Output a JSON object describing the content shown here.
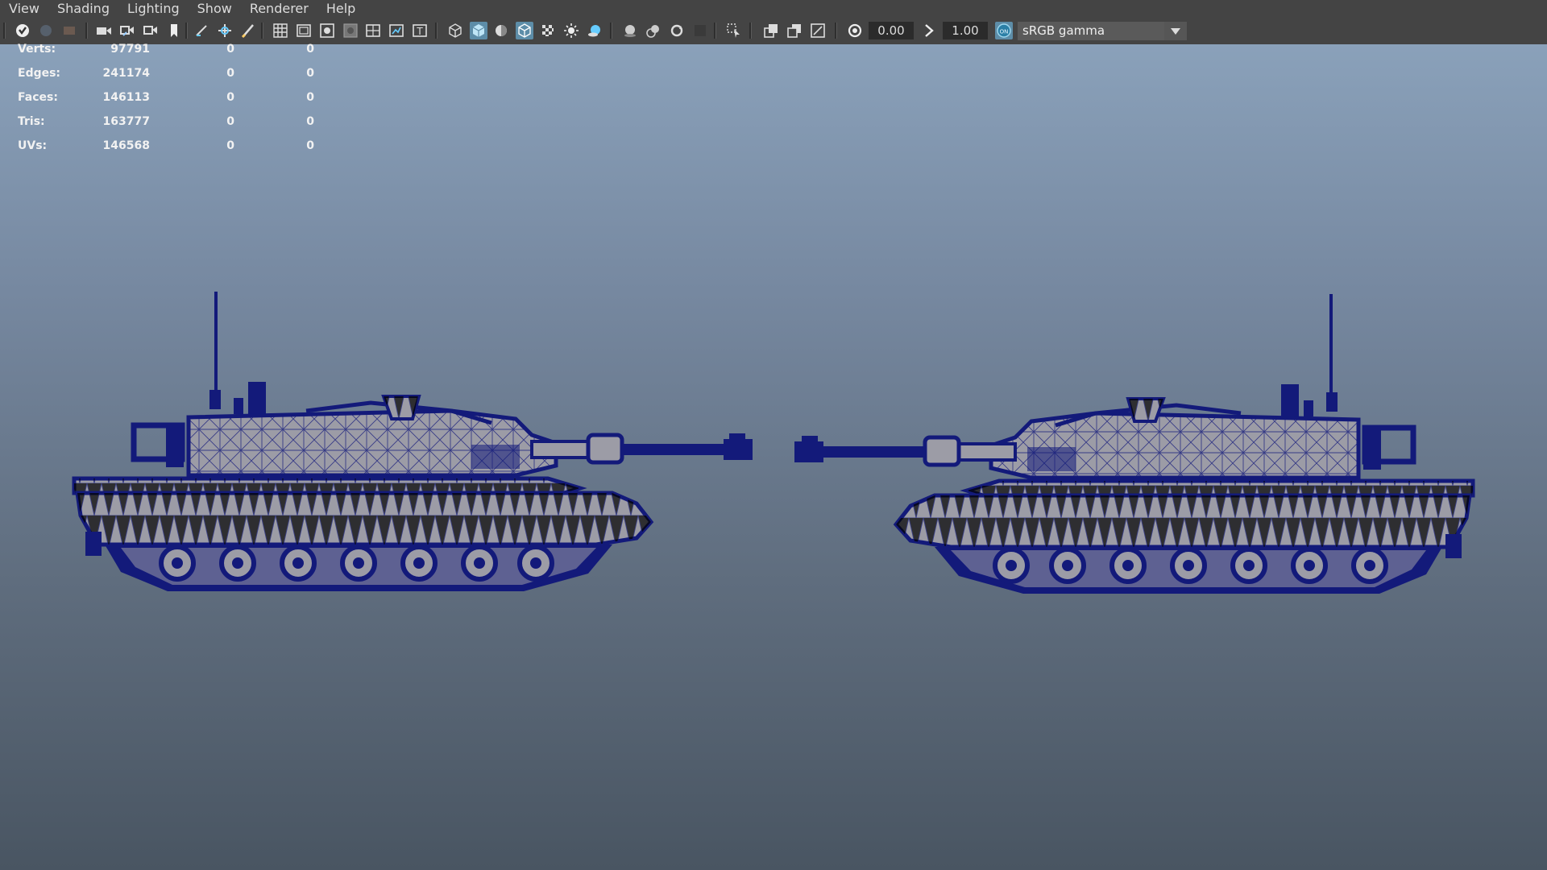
{
  "menu": [
    "View",
    "Shading",
    "Lighting",
    "Show",
    "Renderer",
    "Help"
  ],
  "toolbar": {
    "exposure_value": "0.00",
    "gamma_value": "1.00",
    "color_space": "sRGB gamma",
    "icons": [
      "select-camera-icon",
      "lock-camera-icon",
      "camera-attributes-icon",
      "image-plane-icon",
      "bookmark-icon",
      "camera-2d-pan-icon",
      "grease-pencil-icon",
      "grid-icon",
      "film-gate-icon",
      "resolution-gate-icon",
      "gate-mask-icon",
      "field-chart-icon",
      "safe-action-icon",
      "safe-title-icon",
      "wireframe-icon",
      "smooth-shade-icon",
      "default-material-icon",
      "wireframe-on-shaded-icon",
      "textured-icon",
      "use-all-lights-icon",
      "shadows-icon",
      "screen-space-ao-icon",
      "motion-blur-icon",
      "anti-aliasing-icon",
      "depth-of-field-icon",
      "isolate-select-icon",
      "xray-icon",
      "xray-joints-icon",
      "xray-components-icon",
      "exposure-icon",
      "gamma-icon",
      "color-management-icon"
    ]
  },
  "hud": {
    "rows": [
      {
        "label": "Verts:",
        "total": "97791",
        "selected": "0",
        "third": "0"
      },
      {
        "label": "Edges:",
        "total": "241174",
        "selected": "0",
        "third": "0"
      },
      {
        "label": "Faces:",
        "total": "146113",
        "selected": "0",
        "third": "0"
      },
      {
        "label": "Tris:",
        "total": "163777",
        "selected": "0",
        "third": "0"
      },
      {
        "label": "UVs:",
        "total": "146568",
        "selected": "0",
        "third": "0"
      }
    ]
  },
  "colors": {
    "wireframe": "#131a7a",
    "mesh_fill": "#9c9ca6",
    "active_button": "#5d8da8"
  }
}
